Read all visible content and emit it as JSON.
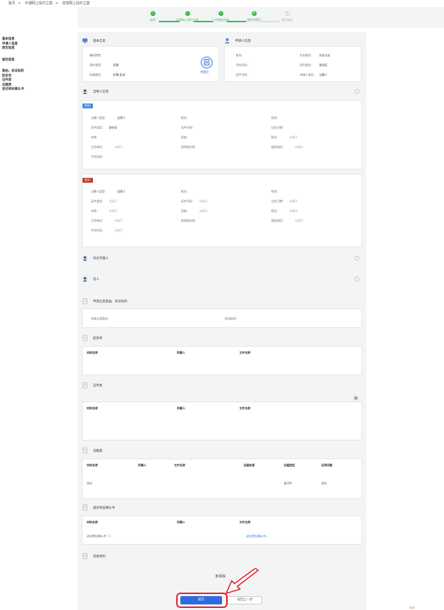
{
  "breadcrumb": [
    "首页",
    "中湖网上投约立案",
    "省辖网上投约立案"
  ],
  "steps": [
    {
      "label": "告知",
      "done": true,
      "num": "✓"
    },
    {
      "label": "选择网上投约立案",
      "done": true,
      "num": "✓"
    },
    {
      "label": "上传相应材料",
      "done": true,
      "num": "✓"
    },
    {
      "label": "预览并提交",
      "done": true,
      "num": "4"
    },
    {
      "label": "提交成功",
      "done": false,
      "num": "5"
    }
  ],
  "sidenav": [
    "基本信息",
    "申请人信息",
    "原告信息",
    "被告信息",
    "案由、诉讼标的",
    "起诉状",
    "证件类",
    "证据类",
    "送达地址确认书"
  ],
  "basic_info": {
    "title": "基本信息",
    "fields": [
      {
        "label": "确标院院：",
        "value": ""
      },
      {
        "label": "案件类型：",
        "value": "民事"
      },
      {
        "label": "申请类型：",
        "value": "民事-起诉"
      }
    ],
    "badge": "待提交"
  },
  "applicant_info": {
    "title": "申请人信息",
    "fields": [
      {
        "label": "姓名：",
        "value": ""
      },
      {
        "label": "实名情况：",
        "value": "实名认证"
      },
      {
        "label": "手机号码：",
        "value": ""
      },
      {
        "label": "证件类型：",
        "value": "身份证"
      },
      {
        "label": "证件号码：",
        "value": ""
      },
      {
        "label": "申请人身份：",
        "value": "当事人"
      }
    ]
  },
  "party_section_title": "当事人信息",
  "plaintiff": {
    "tag": "原告1",
    "fields": [
      {
        "label": "当事人类型：",
        "value": "自然人"
      },
      {
        "label": "姓名：",
        "value": ""
      },
      {
        "label": "性别：",
        "value": ""
      },
      {
        "label": "证件类型：",
        "value": "身份证"
      },
      {
        "label": "证件号码：",
        "value": ""
      },
      {
        "label": "出生日期：",
        "value": ""
      },
      {
        "label": "年龄：",
        "value": ""
      },
      {
        "label": "民族：",
        "value": ""
      },
      {
        "label": "职业：",
        "value": "未填写"
      },
      {
        "label": "工作单位：",
        "value": "未填写"
      },
      {
        "label": "经常居住地：",
        "value": ""
      },
      {
        "label": "固定电话：",
        "value": "未填写"
      },
      {
        "label": "手机号码：",
        "value": ""
      }
    ]
  },
  "defendant": {
    "tag": "被告1",
    "fields": [
      {
        "label": "当事人类型：",
        "value": "自然人"
      },
      {
        "label": "姓名：",
        "value": ""
      },
      {
        "label": "性别：",
        "value": ""
      },
      {
        "label": "证件类型：",
        "value": "未填写"
      },
      {
        "label": "证件号码：",
        "value": "未填写"
      },
      {
        "label": "出生日期：",
        "value": "未填写"
      },
      {
        "label": "年龄：",
        "value": "未填写"
      },
      {
        "label": "民族：",
        "value": "未填写"
      },
      {
        "label": "职业：",
        "value": "未填写"
      },
      {
        "label": "工作单位：",
        "value": "未填写"
      },
      {
        "label": "经常居住地：",
        "value": ""
      },
      {
        "label": "固定电话：",
        "value": "未填写"
      },
      {
        "label": "手机号码：",
        "value": "未填写"
      }
    ]
  },
  "agent_title": "诉讼代理人",
  "witness_title": "证人",
  "case_cause": {
    "title": "申请立案案由、诉讼标的",
    "fields": [
      {
        "label": "申请立案案由：",
        "value": ""
      },
      {
        "label": "诉讼标的：",
        "value": ""
      }
    ]
  },
  "complaint": {
    "title": "起诉状",
    "headers": [
      "材料名称",
      "所属人",
      "文件名称"
    ]
  },
  "id_docs": {
    "title": "证件类",
    "headers": [
      "材料名称",
      "所属人",
      "文件名称"
    ]
  },
  "evidence": {
    "title": "证据类",
    "headers": [
      "材料名称",
      "所属人",
      "文件名称",
      "证据来源",
      "证据类型",
      "证明问题"
    ],
    "rows": [
      [
        "测试",
        "",
        "",
        "",
        "复印件",
        "测试"
      ]
    ]
  },
  "service": {
    "title": "送达地址确认书",
    "headers": [
      "材料名称",
      "所属人",
      "文件名称"
    ],
    "rows": [
      [
        "送达地址确认书（    ）",
        "",
        "送达地址确认书..."
      ]
    ]
  },
  "other": {
    "title": "其他材料",
    "empty": "未添加"
  },
  "buttons": {
    "submit": "提交",
    "back": "返回上一步"
  },
  "corner_text": "头条"
}
